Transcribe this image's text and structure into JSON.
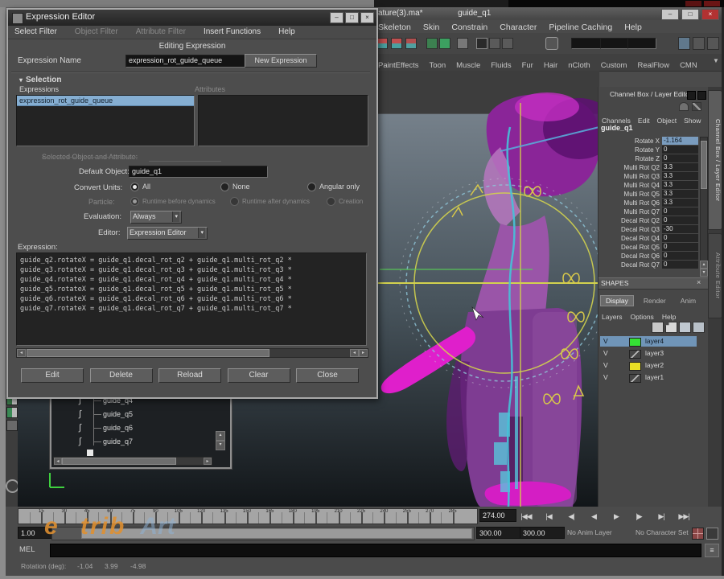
{
  "icons": {
    "minimize": "–",
    "maximize": "□",
    "close": "×",
    "caret_down": "▼",
    "left": "◂",
    "right": "▸",
    "up": "▴",
    "down": "▾",
    "menu": "≡"
  },
  "main_window": {
    "title_left": "ature(3).ma*",
    "title_right": "guide_q1",
    "window_buttons": [
      {
        "name": "minimize",
        "glyph": "–"
      },
      {
        "name": "maximize",
        "glyph": "□"
      },
      {
        "name": "close",
        "glyph": "×"
      }
    ],
    "menu_items": [
      "Skeleton",
      "Skin",
      "Constrain",
      "Character",
      "Pipeline Caching",
      "Help"
    ],
    "shelf_tabs": [
      "PaintEffects",
      "Toon",
      "Muscle",
      "Fluids",
      "Fur",
      "Hair",
      "nCloth",
      "Custom",
      "RealFlow",
      "CMN"
    ]
  },
  "expression_editor": {
    "title": "Expression Editor",
    "menus": [
      {
        "label": "Select Filter",
        "enabled": true
      },
      {
        "label": "Object Filter",
        "enabled": false
      },
      {
        "label": "Attribute Filter",
        "enabled": false
      },
      {
        "label": "Insert Functions",
        "enabled": true
      },
      {
        "label": "Help",
        "enabled": true
      }
    ],
    "editing_label": "Editing Expression",
    "expression_name_label": "Expression Name",
    "expression_name_value": "expression_rot_guide_queue",
    "new_expression_button": "New Expression",
    "selection_header": "Selection",
    "expressions_list_label": "Expressions",
    "attributes_list_label": "Attributes",
    "selected_expression": "expression_rot_guide_queue",
    "selected_object_label": "Selected Object and Attribute:",
    "default_object_label": "Default Object:",
    "default_object_value": "guide_q1",
    "convert_units_label": "Convert Units:",
    "convert_units_options": [
      {
        "label": "All",
        "selected": true
      },
      {
        "label": "None",
        "selected": false
      },
      {
        "label": "Angular only",
        "selected": false
      }
    ],
    "particle_label": "Particle:",
    "particle_options": [
      {
        "label": "Runtime before dynamics",
        "selected": true
      },
      {
        "label": "Runtime after dynamics",
        "selected": false
      },
      {
        "label": "Creation",
        "selected": false
      }
    ],
    "evaluation_label": "Evaluation:",
    "evaluation_value": "Always",
    "editor_label": "Editor:",
    "editor_value": "Expression Editor",
    "expression_label": "Expression:",
    "expression_lines": [
      "guide_q2.rotateX = guide_q1.decal_rot_q2 + guide_q1.multi_rot_q2 *",
      "guide_q3.rotateX = guide_q1.decal_rot_q3 + guide_q1.multi_rot_q3 *",
      "guide_q4.rotateX = guide_q1.decal_rot_q4 + guide_q1.multi_rot_q4 *",
      "guide_q5.rotateX = guide_q1.decal_rot_q5 + guide_q1.multi_rot_q5 *",
      "guide_q6.rotateX = guide_q1.decal_rot_q6 + guide_q1.multi_rot_q6 *",
      "guide_q7.rotateX = guide_q1.decal_rot_q7 + guide_q1.multi_rot_q7 *"
    ],
    "buttons": [
      "Edit",
      "Delete",
      "Reload",
      "Clear",
      "Close"
    ]
  },
  "outliner": {
    "items": [
      "guide_q4",
      "guide_q5",
      "guide_q6",
      "guide_q7"
    ]
  },
  "channel_box": {
    "title": "Channel Box / Layer Editor",
    "menus": [
      "Channels",
      "Edit",
      "Object",
      "Show"
    ],
    "object_name": "guide_q1",
    "attributes": [
      {
        "name": "Rotate X",
        "value": "-1.164",
        "selected": true
      },
      {
        "name": "Rotate Y",
        "value": "0",
        "selected": false
      },
      {
        "name": "Rotate Z",
        "value": "0",
        "selected": false
      },
      {
        "name": "Multi Rot Q2",
        "value": "3.3",
        "selected": false
      },
      {
        "name": "Multi Rot Q3",
        "value": "3.3",
        "selected": false
      },
      {
        "name": "Multi Rot Q4",
        "value": "3.3",
        "selected": false
      },
      {
        "name": "Multi Rot Q5",
        "value": "3.3",
        "selected": false
      },
      {
        "name": "Multi Rot Q6",
        "value": "3.3",
        "selected": false
      },
      {
        "name": "Multi Rot Q7",
        "value": "0",
        "selected": false
      },
      {
        "name": "Decal Rot Q2",
        "value": "0",
        "selected": false
      },
      {
        "name": "Decal Rot Q3",
        "value": "-30",
        "selected": false
      },
      {
        "name": "Decal Rot Q4",
        "value": "0",
        "selected": false
      },
      {
        "name": "Decal Rot Q5",
        "value": "0",
        "selected": false
      },
      {
        "name": "Decal Rot Q6",
        "value": "0",
        "selected": false
      },
      {
        "name": "Decal Rot Q7",
        "value": "0",
        "selected": false
      }
    ],
    "shapes_label": "SHAPES",
    "layer_tabs": [
      {
        "label": "Display",
        "active": true
      },
      {
        "label": "Render",
        "active": false
      },
      {
        "label": "Anim",
        "active": false
      }
    ],
    "layer_menus": [
      "Layers",
      "Options",
      "Help"
    ],
    "visibility_flag": "V",
    "layers": [
      {
        "name": "layer4",
        "color": "#35e035",
        "selected": true
      },
      {
        "name": "layer3",
        "color": null,
        "selected": false
      },
      {
        "name": "layer2",
        "color": "#e8df25",
        "selected": false
      },
      {
        "name": "layer1",
        "color": null,
        "selected": false
      }
    ]
  },
  "right_tabs": [
    {
      "label": "Channel Box / Layer Editor",
      "active": true
    },
    {
      "label": "Attribute Editor",
      "active": false
    }
  ],
  "timeline": {
    "tick_values": [
      15,
      30,
      45,
      60,
      75,
      90,
      105,
      120,
      135,
      150,
      165,
      180,
      195,
      210,
      225,
      240,
      255,
      270,
      285
    ],
    "frame_total": 300,
    "current_time": "274.00",
    "range_start": "1.00",
    "range_end_a": "300.00",
    "range_end_b": "300.00",
    "anim_layer": "No Anim Layer",
    "character_set": "No Character Set",
    "playback_buttons": [
      {
        "name": "go-to-start",
        "glyph": "|◀◀"
      },
      {
        "name": "step-back-key",
        "glyph": "|◀"
      },
      {
        "name": "step-back-frame",
        "glyph": "◀|"
      },
      {
        "name": "play-backward",
        "glyph": "◀"
      },
      {
        "name": "play-forward",
        "glyph": "▶"
      },
      {
        "name": "step-forward-frame",
        "glyph": "|▶"
      },
      {
        "name": "step-forward-key",
        "glyph": "▶|"
      },
      {
        "name": "go-to-end",
        "glyph": "▶▶|"
      }
    ]
  },
  "command_line": {
    "label": "MEL",
    "value": ""
  },
  "help_line": {
    "label": "Rotation (deg):",
    "values": [
      "-1.04",
      "3.99",
      "-4.98"
    ]
  },
  "watermark": {
    "part1": "e trib",
    "part2": "Art"
  },
  "colors": {
    "selection_blue": "#85aed2",
    "layer_green": "#35e035",
    "layer_yellow": "#e8df25",
    "close_red": "#b23232"
  }
}
